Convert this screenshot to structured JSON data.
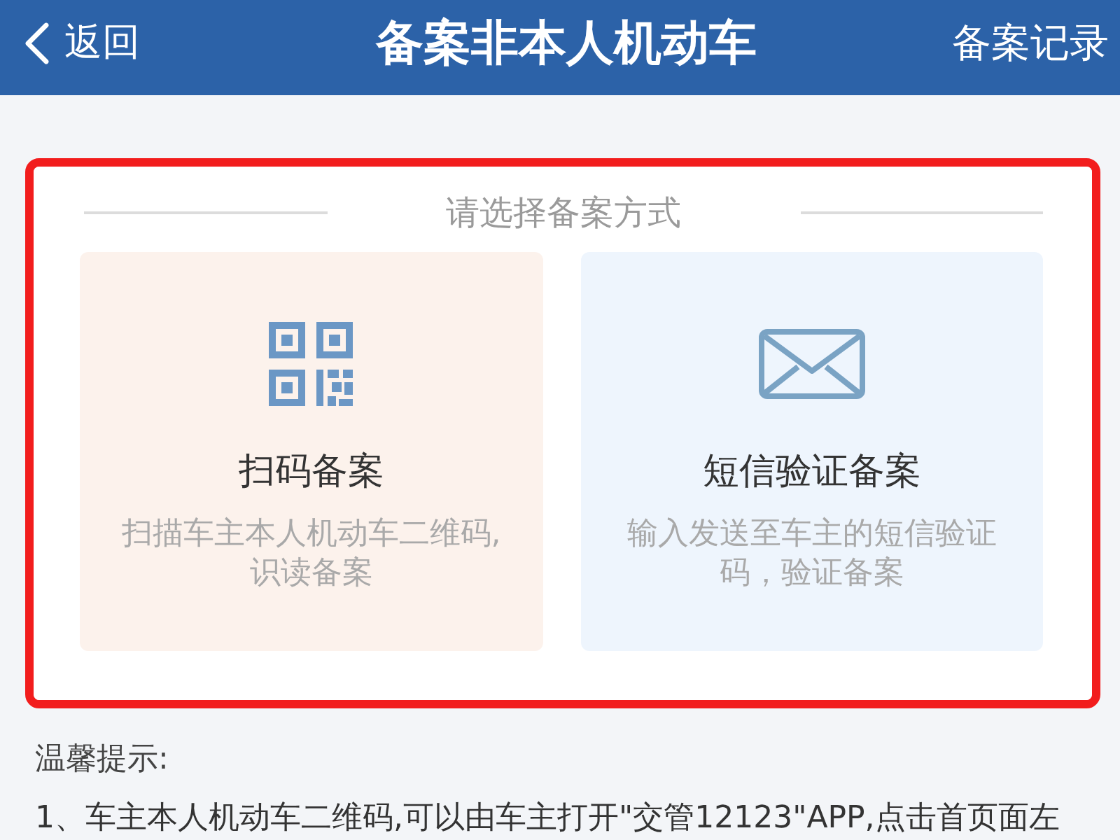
{
  "header": {
    "back": {
      "label": "返回"
    },
    "title": "备案非本人机动车",
    "action": "备案记录"
  },
  "method_picker": {
    "heading": "请选择备案方式",
    "options": [
      {
        "kind": "qr",
        "title": "扫码备案",
        "description": "扫描车主本人机动车二维码,识读备案"
      },
      {
        "kind": "sms",
        "title": "短信验证备案",
        "description": "输入发送至车主的短信验证码，验证备案"
      }
    ]
  },
  "tips": {
    "heading": "温馨提示:",
    "items": [
      "1、车主本人机动车二维码,可以由车主打开\"交管12123\"APP,点击首页面左"
    ]
  }
}
